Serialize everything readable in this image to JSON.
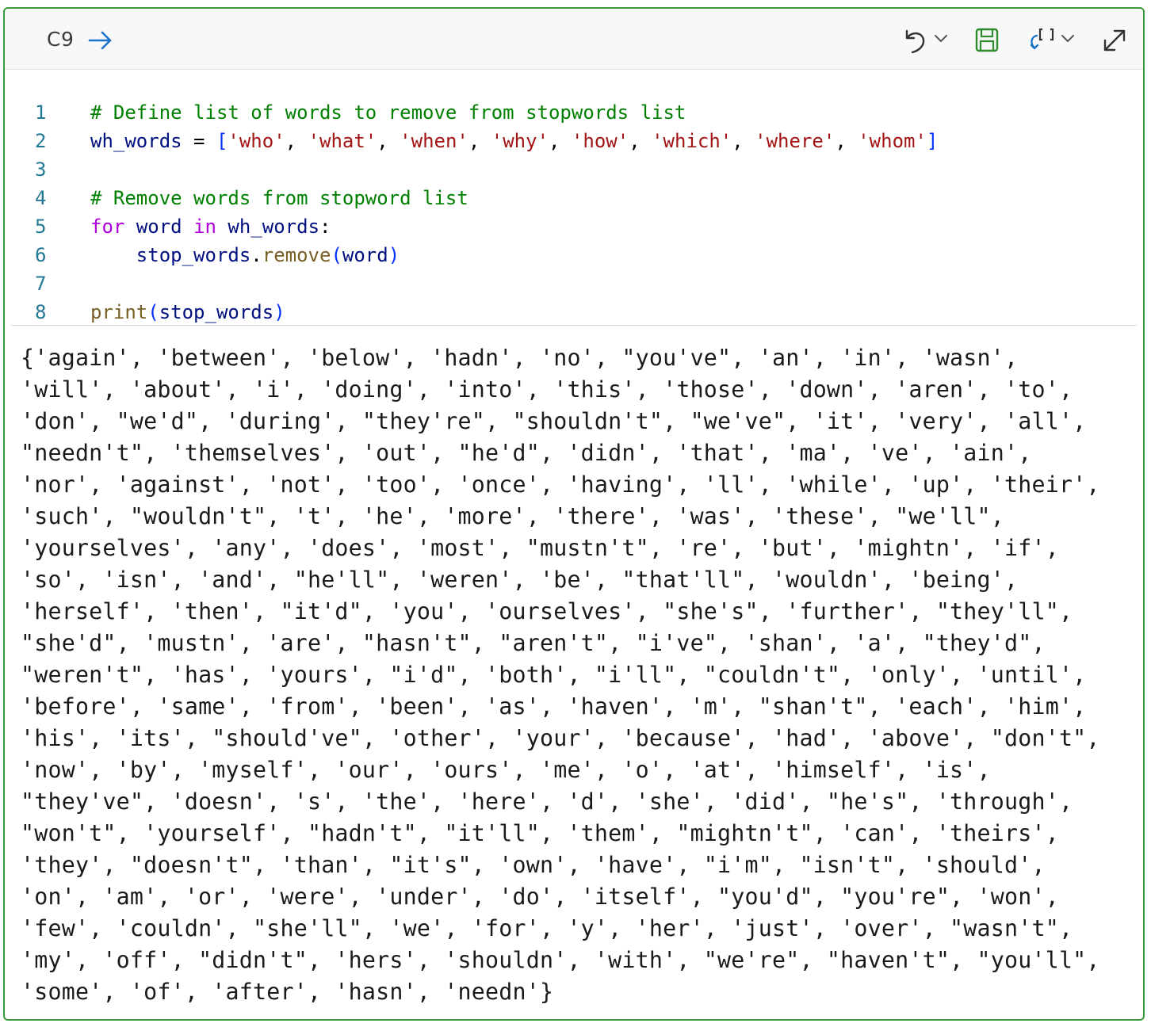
{
  "cell": {
    "id": "C9"
  },
  "code_lines": [
    {
      "num": "1",
      "tokens": [
        {
          "c": "cm",
          "t": "# Define list of words to remove from stopwords list"
        }
      ]
    },
    {
      "num": "2",
      "tokens": [
        {
          "c": "vr",
          "t": "wh_words"
        },
        {
          "c": "pn",
          "t": " = "
        },
        {
          "c": "br",
          "t": "["
        },
        {
          "c": "st",
          "t": "'who'"
        },
        {
          "c": "pn",
          "t": ", "
        },
        {
          "c": "st",
          "t": "'what'"
        },
        {
          "c": "pn",
          "t": ", "
        },
        {
          "c": "st",
          "t": "'when'"
        },
        {
          "c": "pn",
          "t": ", "
        },
        {
          "c": "st",
          "t": "'why'"
        },
        {
          "c": "pn",
          "t": ", "
        },
        {
          "c": "st",
          "t": "'how'"
        },
        {
          "c": "pn",
          "t": ", "
        },
        {
          "c": "st",
          "t": "'which'"
        },
        {
          "c": "pn",
          "t": ", "
        },
        {
          "c": "st",
          "t": "'where'"
        },
        {
          "c": "pn",
          "t": ", "
        },
        {
          "c": "st",
          "t": "'whom'"
        },
        {
          "c": "br",
          "t": "]"
        }
      ]
    },
    {
      "num": "3",
      "tokens": []
    },
    {
      "num": "4",
      "tokens": [
        {
          "c": "cm",
          "t": "# Remove words from stopword list"
        }
      ]
    },
    {
      "num": "5",
      "tokens": [
        {
          "c": "kw",
          "t": "for"
        },
        {
          "c": "pn",
          "t": " "
        },
        {
          "c": "vr",
          "t": "word"
        },
        {
          "c": "pn",
          "t": " "
        },
        {
          "c": "kw",
          "t": "in"
        },
        {
          "c": "pn",
          "t": " "
        },
        {
          "c": "vr",
          "t": "wh_words"
        },
        {
          "c": "pn",
          "t": ":"
        }
      ]
    },
    {
      "num": "6",
      "tokens": [
        {
          "c": "pn",
          "t": "    "
        },
        {
          "c": "vr",
          "t": "stop_words"
        },
        {
          "c": "pn",
          "t": "."
        },
        {
          "c": "fn",
          "t": "remove"
        },
        {
          "c": "br",
          "t": "("
        },
        {
          "c": "vr",
          "t": "word"
        },
        {
          "c": "br",
          "t": ")"
        }
      ]
    },
    {
      "num": "7",
      "tokens": []
    },
    {
      "num": "8",
      "tokens": [
        {
          "c": "fn",
          "t": "print"
        },
        {
          "c": "br",
          "t": "("
        },
        {
          "c": "vr",
          "t": "stop_words"
        },
        {
          "c": "br",
          "t": ")"
        }
      ]
    }
  ],
  "output_lines": [
    "{'again', 'between', 'below', 'hadn', 'no', \"you've\", 'an', 'in', 'wasn',",
    "'will', 'about', 'i', 'doing', 'into', 'this', 'those', 'down', 'aren', 'to',",
    "'don', \"we'd\", 'during', \"they're\", \"shouldn't\", \"we've\", 'it', 'very', 'all',",
    "\"needn't\", 'themselves', 'out', \"he'd\", 'didn', 'that', 'ma', 've', 'ain',",
    "'nor', 'against', 'not', 'too', 'once', 'having', 'll', 'while', 'up', 'their',",
    "'such', \"wouldn't\", 't', 'he', 'more', 'there', 'was', 'these', \"we'll\",",
    "'yourselves', 'any', 'does', 'most', \"mustn't\", 're', 'but', 'mightn', 'if',",
    "'so', 'isn', 'and', \"he'll\", 'weren', 'be', \"that'll\", 'wouldn', 'being',",
    "'herself', 'then', \"it'd\", 'you', 'ourselves', \"she's\", 'further', \"they'll\",",
    "\"she'd\", 'mustn', 'are', \"hasn't\", \"aren't\", \"i've\", 'shan', 'a', \"they'd\",",
    "\"weren't\", 'has', 'yours', \"i'd\", 'both', \"i'll\", \"couldn't\", 'only', 'until',",
    "'before', 'same', 'from', 'been', 'as', 'haven', 'm', \"shan't\", 'each', 'him',",
    "'his', 'its', \"should've\", 'other', 'your', 'because', 'had', 'above', \"don't\",",
    "'now', 'by', 'myself', 'our', 'ours', 'me', 'o', 'at', 'himself', 'is',",
    "\"they've\", 'doesn', 's', 'the', 'here', 'd', 'she', 'did', \"he's\", 'through',",
    "\"won't\", 'yourself', \"hadn't\", \"it'll\", 'them', \"mightn't\", 'can', 'theirs',",
    "'they', \"doesn't\", 'than', \"it's\", 'own', 'have', \"i'm\", \"isn't\", 'should',",
    "'on', 'am', 'or', 'were', 'under', 'do', 'itself', \"you'd\", \"you're\", 'won',",
    "'few', 'couldn', \"she'll\", 'we', 'for', 'y', 'her', 'just', 'over', \"wasn't\",",
    "'my', 'off', \"didn't\", 'hers', 'shouldn', 'with', \"we're\", \"haven't\", \"you'll\",",
    "'some', 'of', 'after', 'hasn', 'needn'}"
  ],
  "colors": {
    "border": "#3a9a3a",
    "comment": "#008000",
    "string": "#a31515",
    "keyword": "#af00db",
    "variable": "#001080",
    "function": "#795e26",
    "bracket": "#0431fa",
    "line_number": "#237893"
  },
  "icons": [
    "run-arrow-icon",
    "undo-icon",
    "chevron-down-icon",
    "save-icon",
    "variables-refresh-icon",
    "expand-icon"
  ]
}
